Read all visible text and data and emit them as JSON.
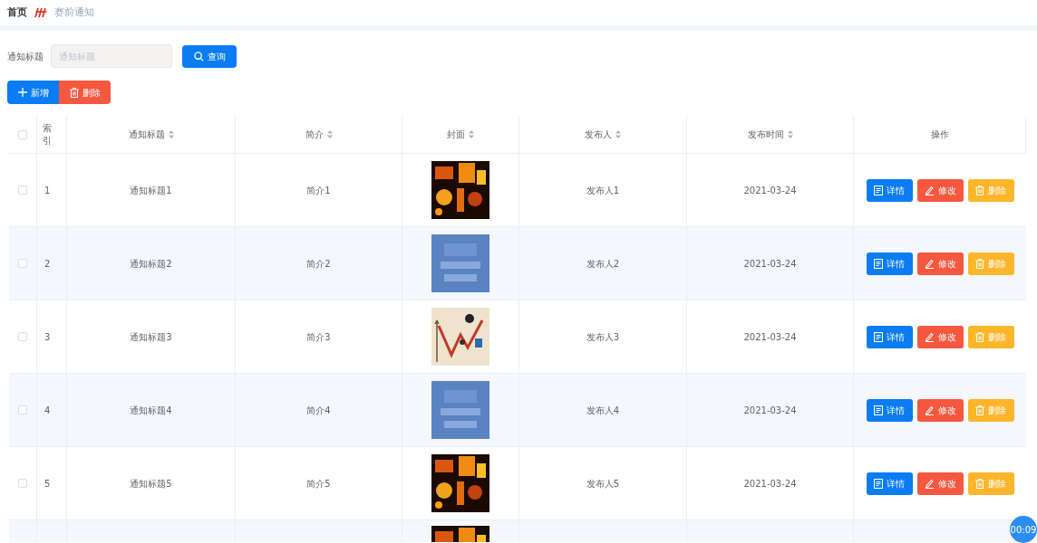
{
  "breadcrumb": [
    {
      "label": "首页",
      "current": false
    },
    {
      "label": "赛前通知",
      "current": true
    }
  ],
  "search": {
    "label": "通知标题",
    "placeholder": "通知标题",
    "button": "查询"
  },
  "toolbar": [
    {
      "kind": "add",
      "label": "新增"
    },
    {
      "kind": "delete",
      "label": "删除"
    }
  ],
  "table": {
    "select_all": {
      "checked": false
    },
    "columns": [
      {
        "label": "索引",
        "sortable": false
      },
      {
        "label": "通知标题",
        "sortable": true
      },
      {
        "label": "简介",
        "sortable": true
      },
      {
        "label": "封面",
        "sortable": true
      },
      {
        "label": "发布人",
        "sortable": true
      },
      {
        "label": "发布时间",
        "sortable": true
      },
      {
        "label": "操作",
        "sortable": false
      }
    ],
    "rows": [
      {
        "checked": false,
        "index": "1",
        "title": "通知标题1",
        "intro": "简介1",
        "publisher": "发布人1",
        "time": "2021-03-24",
        "actions": [
          {
            "kind": "detail",
            "label": "详情"
          },
          {
            "kind": "edit",
            "label": "修改"
          },
          {
            "kind": "delete",
            "label": "删除"
          }
        ]
      },
      {
        "checked": false,
        "index": "2",
        "title": "通知标题2",
        "intro": "简介2",
        "publisher": "发布人2",
        "time": "2021-03-24",
        "actions": [
          {
            "kind": "detail",
            "label": "详情"
          },
          {
            "kind": "edit",
            "label": "修改"
          },
          {
            "kind": "delete",
            "label": "删除"
          }
        ]
      },
      {
        "checked": false,
        "index": "3",
        "title": "通知标题3",
        "intro": "简介3",
        "publisher": "发布人3",
        "time": "2021-03-24",
        "actions": [
          {
            "kind": "detail",
            "label": "详情"
          },
          {
            "kind": "edit",
            "label": "修改"
          },
          {
            "kind": "delete",
            "label": "删除"
          }
        ]
      },
      {
        "checked": false,
        "index": "4",
        "title": "通知标题4",
        "intro": "简介4",
        "publisher": "发布人4",
        "time": "2021-03-24",
        "actions": [
          {
            "kind": "detail",
            "label": "详情"
          },
          {
            "kind": "edit",
            "label": "修改"
          },
          {
            "kind": "delete",
            "label": "删除"
          }
        ]
      },
      {
        "checked": false,
        "index": "5",
        "title": "通知标题5",
        "intro": "简介5",
        "publisher": "发布人5",
        "time": "2021-03-24",
        "actions": [
          {
            "kind": "detail",
            "label": "详情"
          },
          {
            "kind": "edit",
            "label": "修改"
          },
          {
            "kind": "delete",
            "label": "删除"
          }
        ]
      }
    ]
  },
  "timer": "00:09"
}
